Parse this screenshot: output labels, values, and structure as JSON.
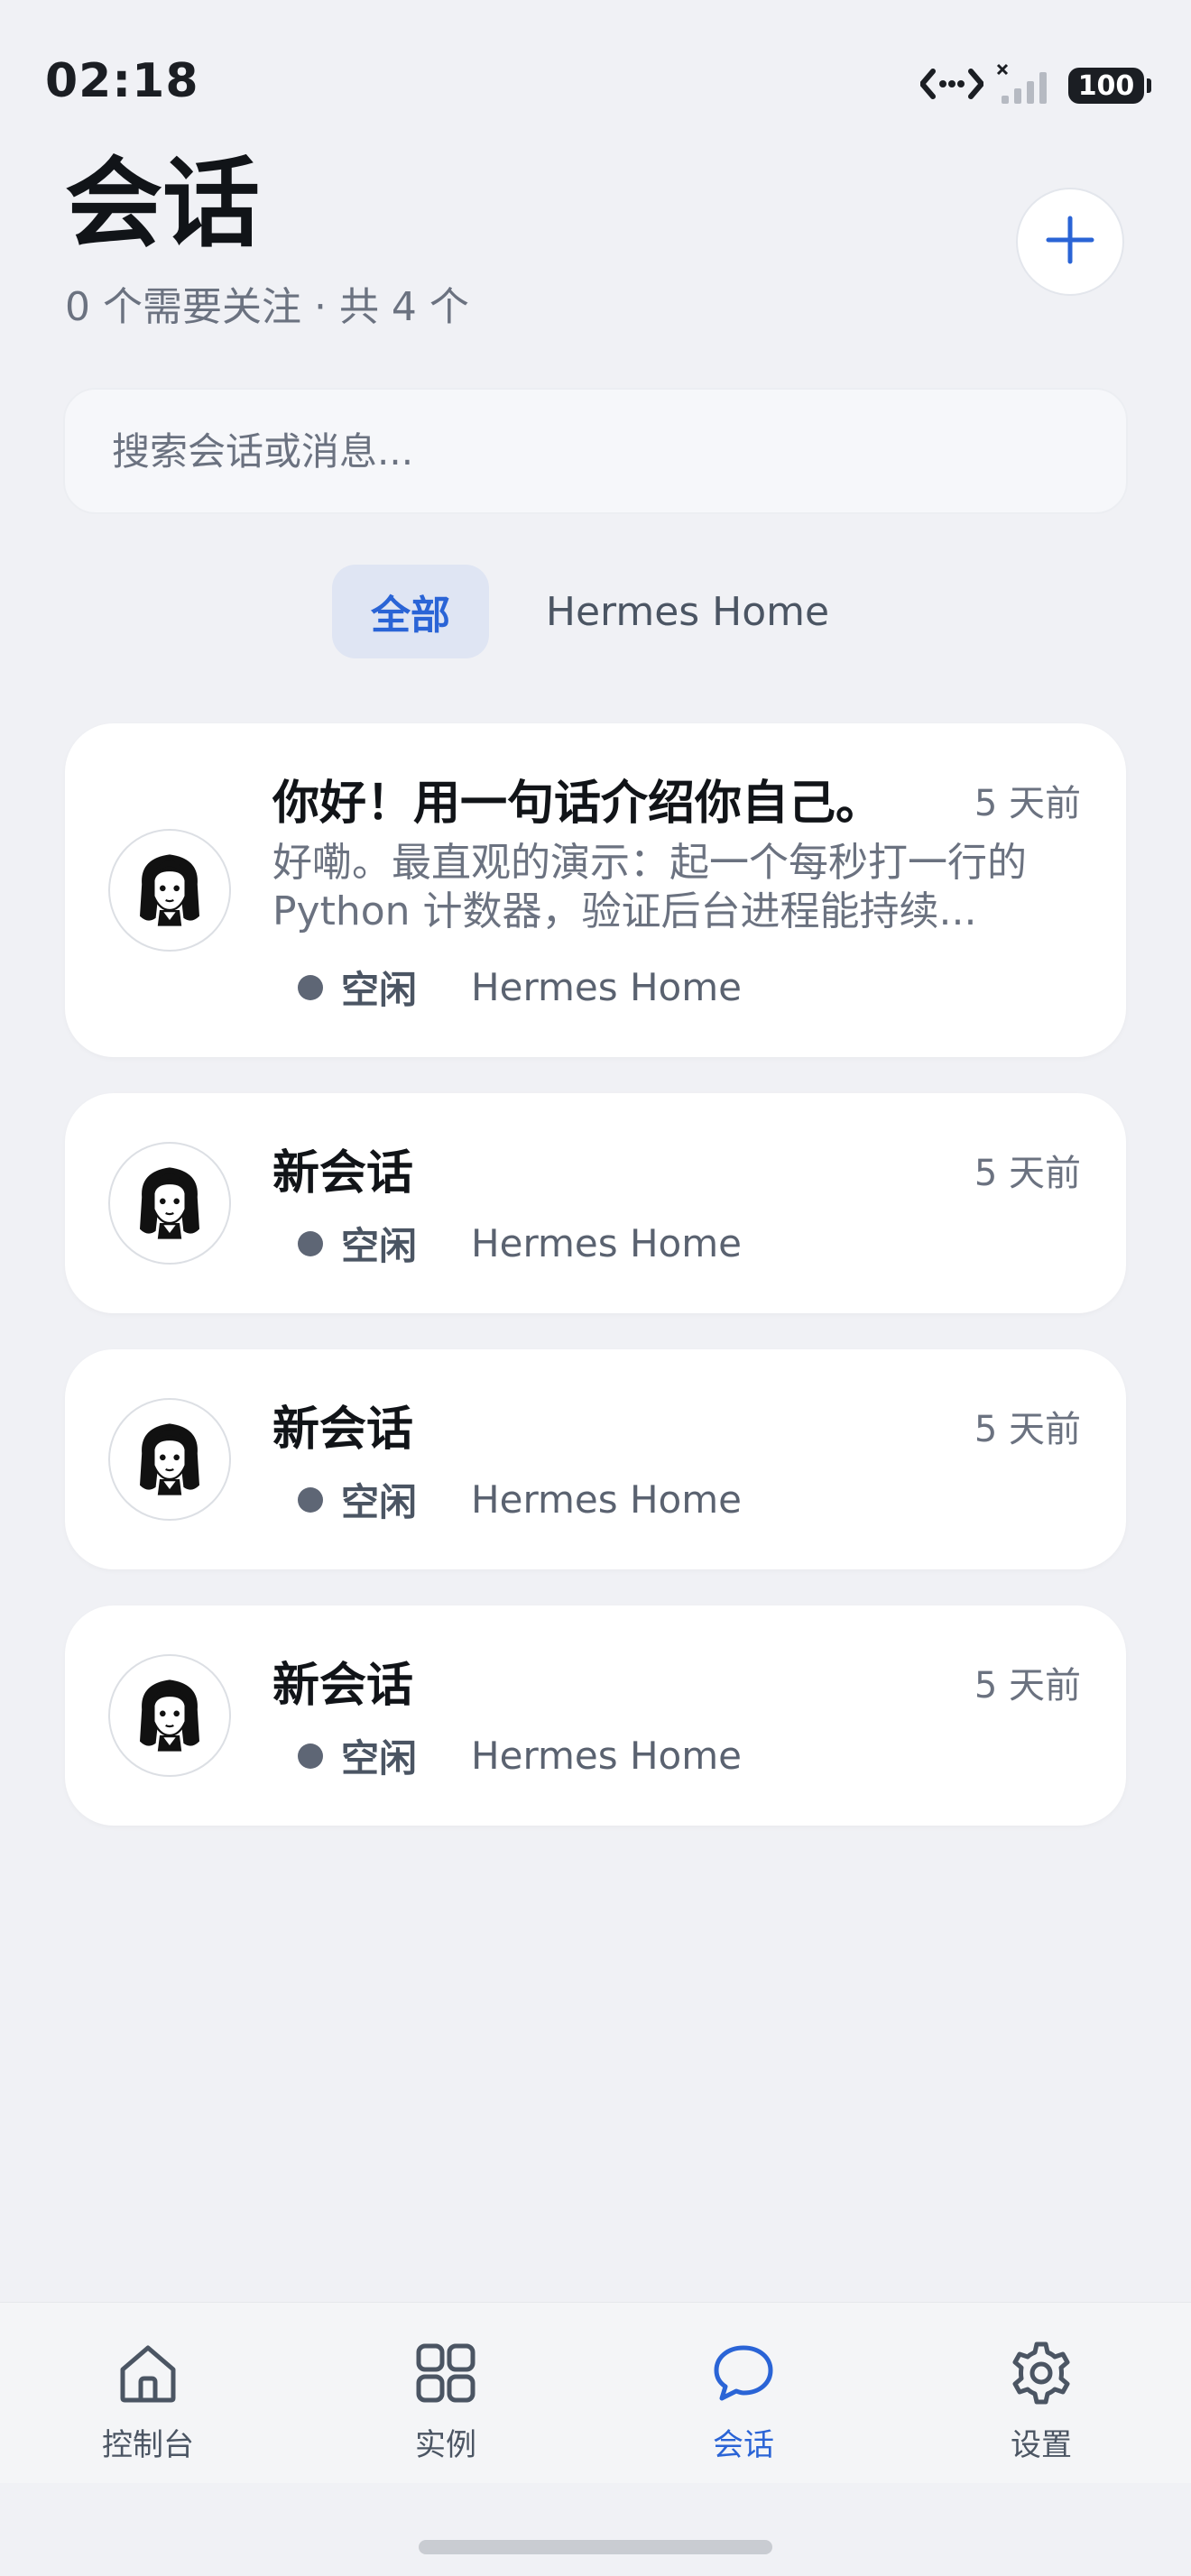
{
  "status_bar": {
    "time": "02:18",
    "battery": "100"
  },
  "header": {
    "title": "会话",
    "subtitle": "0 个需要关注 · 共 4 个"
  },
  "search": {
    "placeholder": "搜索会话或消息..."
  },
  "tabs": [
    {
      "label": "全部",
      "active": true
    },
    {
      "label": "Hermes Home",
      "active": false
    }
  ],
  "conversations": [
    {
      "title": "你好！用一句话介绍你自己。",
      "time": "5 天前",
      "preview": "好嘞。最直观的演示：起一个每秒打一行的 Python 计数器，验证后台进程能持续...",
      "status": "空闲",
      "instance": "Hermes Home"
    },
    {
      "title": "新会话",
      "time": "5 天前",
      "status": "空闲",
      "instance": "Hermes Home"
    },
    {
      "title": "新会话",
      "time": "5 天前",
      "status": "空闲",
      "instance": "Hermes Home"
    },
    {
      "title": "新会话",
      "time": "5 天前",
      "status": "空闲",
      "instance": "Hermes Home"
    }
  ],
  "bottom_nav": [
    {
      "label": "控制台",
      "icon": "home-icon",
      "active": false
    },
    {
      "label": "实例",
      "icon": "grid-icon",
      "active": false
    },
    {
      "label": "会话",
      "icon": "chat-bubble-icon",
      "active": true
    },
    {
      "label": "设置",
      "icon": "gear-icon",
      "active": false
    }
  ],
  "colors": {
    "accent": "#2a64d6",
    "background": "#f0f1f5",
    "card": "#ffffff",
    "status_idle": "#5e6675"
  }
}
